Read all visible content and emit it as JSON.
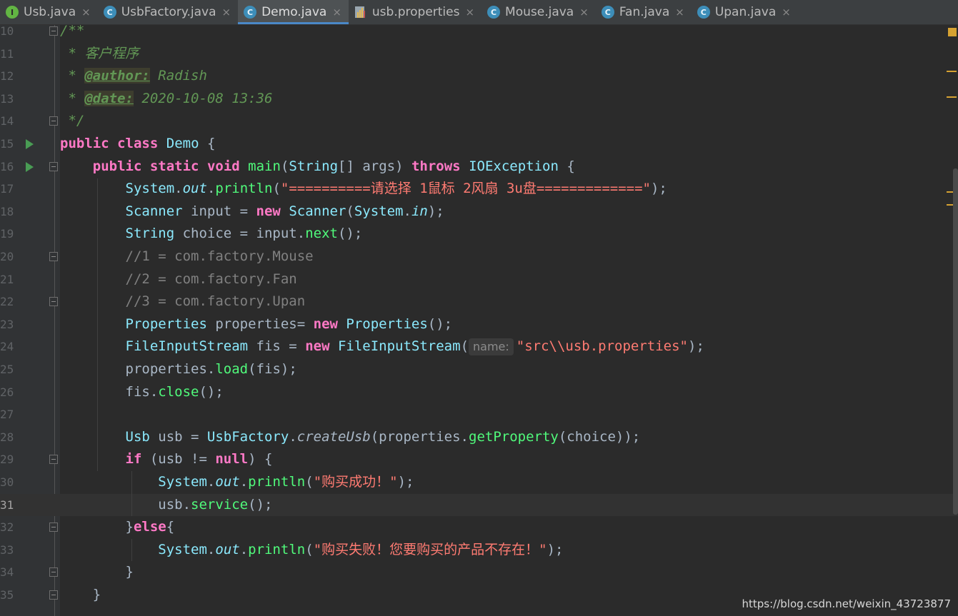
{
  "tabs": [
    {
      "label": "Usb.java",
      "icon": "interface-icon",
      "active": false
    },
    {
      "label": "UsbFactory.java",
      "icon": "class-icon",
      "active": false
    },
    {
      "label": "Demo.java",
      "icon": "class-icon",
      "active": true
    },
    {
      "label": "usb.properties",
      "icon": "properties-file-icon",
      "active": false
    },
    {
      "label": "Mouse.java",
      "icon": "class-icon",
      "active": false
    },
    {
      "label": "Fan.java",
      "icon": "class-icon",
      "active": false
    },
    {
      "label": "Upan.java",
      "icon": "class-icon",
      "active": false
    }
  ],
  "tab_icon_letters": {
    "interface": "I",
    "class": "C"
  },
  "close_glyph": "×",
  "line_numbers": [
    "10",
    "11",
    "12",
    "13",
    "14",
    "15",
    "16",
    "17",
    "18",
    "19",
    "20",
    "21",
    "22",
    "23",
    "24",
    "25",
    "26",
    "27",
    "28",
    "29",
    "30",
    "31",
    "32",
    "33",
    "34",
    "35"
  ],
  "current_line": "31",
  "code": {
    "l10": {
      "doc": "/**"
    },
    "l11": {
      "doc": " * 客户程序"
    },
    "l12": {
      "doc_pre": " * ",
      "tag": "@author:",
      "doc_post": " Radish"
    },
    "l13": {
      "doc_pre": " * ",
      "tag": "@date:",
      "doc_post": " 2020-10-08 13:36"
    },
    "l14": {
      "doc": " */"
    },
    "l15": {
      "kw1": "public",
      "kw2": "class",
      "cls": "Demo",
      "rest": " {"
    },
    "l16": {
      "indent": "    ",
      "kw1": "public",
      "kw2": "static",
      "kw3": "void",
      "mth": "main",
      "p1": "(",
      "cls1": "String",
      "p2": "[] args) ",
      "kw4": "throws",
      "cls2": "IOException",
      "rest": " {"
    },
    "l17": {
      "indent": "        ",
      "cls": "System",
      "dot1": ".",
      "fld": "out",
      "dot2": ".",
      "mth": "println",
      "p1": "(",
      "str": "\"==========请选择 1鼠标 2风扇 3u盘=============\"",
      "rest": ");"
    },
    "l18": {
      "indent": "        ",
      "cls1": "Scanner",
      "var": " input = ",
      "kw": "new",
      "cls2": "Scanner",
      "p1": "(",
      "cls3": "System",
      "dot": ".",
      "fld": "in",
      "rest": ");"
    },
    "l19": {
      "indent": "        ",
      "cls": "String",
      "var": " choice = input.",
      "mth": "next",
      "rest": "();"
    },
    "l20": {
      "indent": "        ",
      "cmt": "//1 = com.factory.Mouse"
    },
    "l21": {
      "indent": "        ",
      "cmt": "//2 = com.factory.Fan"
    },
    "l22": {
      "indent": "        ",
      "cmt": "//3 = com.factory.Upan"
    },
    "l23": {
      "indent": "        ",
      "cls1": "Properties",
      "var": " properties= ",
      "kw": "new",
      "cls2": "Properties",
      "rest": "();"
    },
    "l24": {
      "indent": "        ",
      "cls1": "FileInputStream",
      "var": " fis = ",
      "kw": "new",
      "cls2": "FileInputStream",
      "p1": "(",
      "hint": "name:",
      "str": "\"src\\\\usb.properties\"",
      "rest": ");"
    },
    "l25": {
      "indent": "        ",
      "var": "properties.",
      "mth": "load",
      "rest": "(fis);"
    },
    "l26": {
      "indent": "        ",
      "var": "fis.",
      "mth": "close",
      "rest": "();"
    },
    "l27": {
      "text": ""
    },
    "l28": {
      "indent": "        ",
      "cls1": "Usb",
      "var": " usb = ",
      "cls2": "UsbFactory",
      "dot": ".",
      "smth": "createUsb",
      "p1": "(properties.",
      "mth": "getProperty",
      "rest": "(choice));"
    },
    "l29": {
      "indent": "        ",
      "kw1": "if",
      "p1": " (usb != ",
      "kw2": "null",
      "rest": ") {"
    },
    "l30": {
      "indent": "            ",
      "cls": "System",
      "dot1": ".",
      "fld": "out",
      "dot2": ".",
      "mth": "println",
      "p1": "(",
      "str": "\"购买成功！\"",
      "rest": ");"
    },
    "l31": {
      "indent": "            ",
      "var": "usb.",
      "mth": "service",
      "rest": "();"
    },
    "l32": {
      "indent": "        ",
      "p1": "}",
      "kw": "else",
      "rest": "{"
    },
    "l33": {
      "indent": "            ",
      "cls": "System",
      "dot1": ".",
      "fld": "out",
      "dot2": ".",
      "mth": "println",
      "p1": "(",
      "str": "\"购买失败！您要购买的产品不存在！\"",
      "rest": ");"
    },
    "l34": {
      "indent": "        ",
      "rest": "}"
    },
    "l35": {
      "indent": "    ",
      "rest": "}"
    }
  },
  "colors": {
    "background": "#2b2b2b",
    "keyword": "#ff79c6",
    "class": "#8be9fd",
    "method": "#50fa7b",
    "string": "#ff7b72",
    "doc": "#629755",
    "comment": "#808080",
    "run_marker": "#499c54",
    "warning_mark": "#d6a232",
    "active_tab_underline": "#4a88c7"
  },
  "watermark": "https://blog.csdn.net/weixin_43723877"
}
